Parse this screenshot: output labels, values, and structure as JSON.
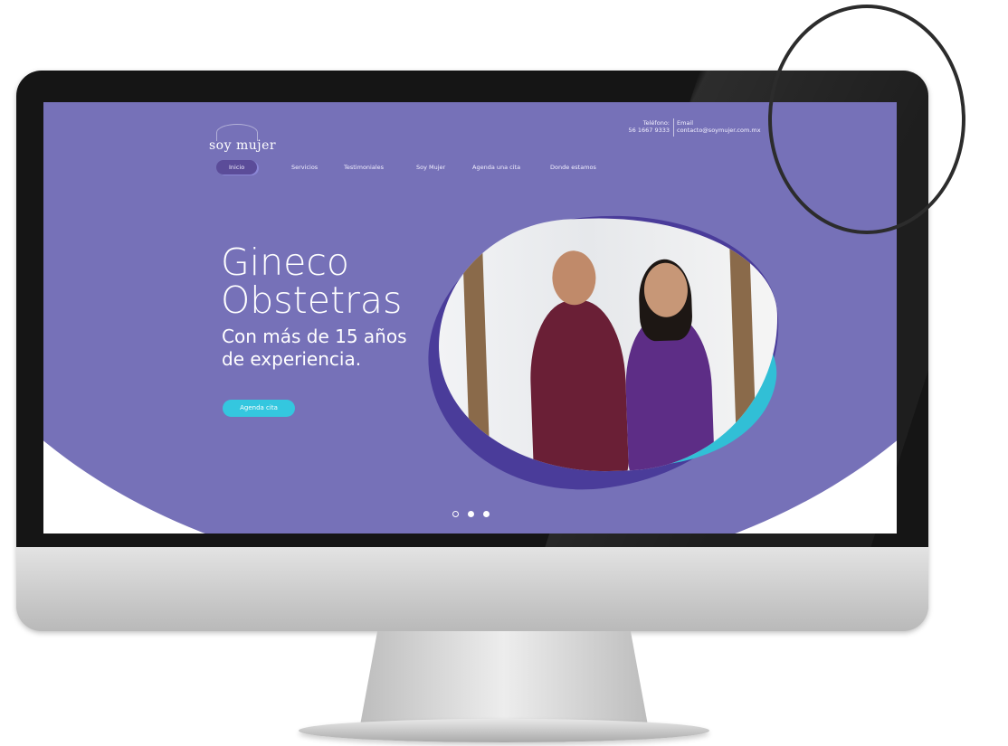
{
  "site": {
    "logo_text": "soy mujer",
    "contact": {
      "phone_label": "Teléfono:",
      "phone_value": "56 1667 9333",
      "email_label": "Email",
      "email_value": "contacto@soymujer.com.mx"
    },
    "nav": [
      {
        "label": "Inicio",
        "active": true
      },
      {
        "label": "Servicios",
        "active": false
      },
      {
        "label": "Testimoniales",
        "active": false
      },
      {
        "label": "Soy Mujer",
        "active": false
      },
      {
        "label": "Agenda una cita",
        "active": false
      },
      {
        "label": "Donde estamos",
        "active": false
      }
    ],
    "hero": {
      "title_line1": "Gineco",
      "title_line2": "Obstetras",
      "subtitle_line1": "Con más de 15 años",
      "subtitle_line2": "de experiencia.",
      "cta_label": "Agenda cita"
    },
    "carousel": {
      "slides": 3,
      "active_index": 0
    }
  },
  "colors": {
    "hero_purple": "#7671b8",
    "blob_dark": "#4a3c9a",
    "accent_teal": "#34c7df",
    "nav_active": "#5b4c99"
  }
}
